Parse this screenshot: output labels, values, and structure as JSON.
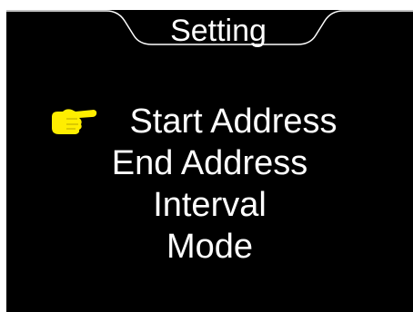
{
  "header": {
    "title": "Setting"
  },
  "menu": {
    "selected_index": 0,
    "items": [
      {
        "label": "Start Address"
      },
      {
        "label": "End Address"
      },
      {
        "label": "Interval"
      },
      {
        "label": "Mode"
      }
    ]
  },
  "icons": {
    "selector": "pointing-hand-icon"
  },
  "colors": {
    "background": "#000000",
    "text": "#ffffff",
    "pointer": "#ffee00",
    "frame": "#ffffff"
  }
}
